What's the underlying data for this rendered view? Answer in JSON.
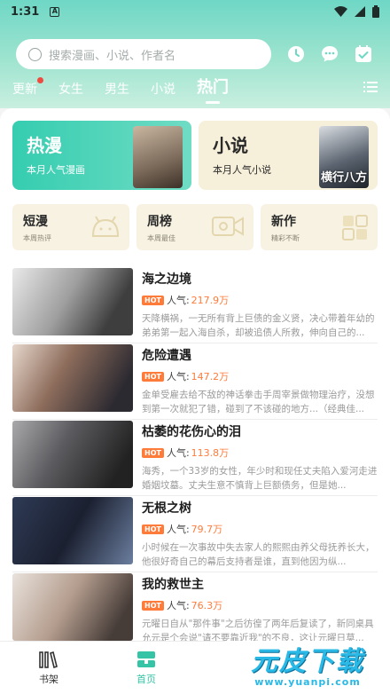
{
  "status_bar": {
    "time": "1:31",
    "notification_icon": "A"
  },
  "search": {
    "placeholder": "搜索漫画、小说、作者名"
  },
  "tabs": [
    {
      "label": "更新",
      "badge": true
    },
    {
      "label": "女生"
    },
    {
      "label": "男生"
    },
    {
      "label": "小说"
    },
    {
      "label": "热门",
      "active": true
    }
  ],
  "featured": [
    {
      "title": "热漫",
      "subtitle": "本月人气漫画",
      "cover_text": ""
    },
    {
      "title": "小说",
      "subtitle": "本月人气小说",
      "cover_text": "横行八方"
    }
  ],
  "categories": [
    {
      "title": "短漫",
      "subtitle": "本周热评"
    },
    {
      "title": "周榜",
      "subtitle": "本周最佳"
    },
    {
      "title": "新作",
      "subtitle": "精彩不断"
    }
  ],
  "popularity_label": "人气:",
  "hot_badge": "HOT",
  "items": [
    {
      "title": "海之边境",
      "popularity": "217.9万",
      "desc": "天降横祸，一无所有背上巨债的金义贤，决心带着年幼的弟弟第一起入海自杀，却被追债人所救，伸向自己的..."
    },
    {
      "title": "危险遭遇",
      "popularity": "147.2万",
      "desc": "金单受雇去给不敌的神话拳击手周宰景做物理治疗，没想到第一次就犯了错，碰到了不该碰的地方...（经典佳..."
    },
    {
      "title": "枯萎的花伤心的泪",
      "popularity": "113.8万",
      "desc": "海秀，一个33岁的女性，年少时和现任丈夫陷入爱河走进婚姻坟墓。丈夫生意不慎背上巨额债务，但是她..."
    },
    {
      "title": "无根之树",
      "popularity": "79.7万",
      "desc": "小时候在一次事故中失去家人的熙熙由养父母抚养长大，他很好奇自己的幕后支持者是谁，直到他因为纵..."
    },
    {
      "title": "我的救世主",
      "popularity": "76.3万",
      "desc": "元曜日自从\"那件事\"之后彷徨了两年后复读了，新同桌具允元是个会说\"请不要靠近我\"的不良，这让元曜日莫..."
    }
  ],
  "bottom_nav": [
    {
      "label": "书架"
    },
    {
      "label": "首页",
      "active": true
    }
  ],
  "watermark": {
    "main": "元皮下载",
    "sub": "www.yuanpi.com"
  },
  "colors": {
    "accent": "#35c4a6",
    "hot": "#ff7b3a",
    "badge_red": "#ef4a3f"
  }
}
